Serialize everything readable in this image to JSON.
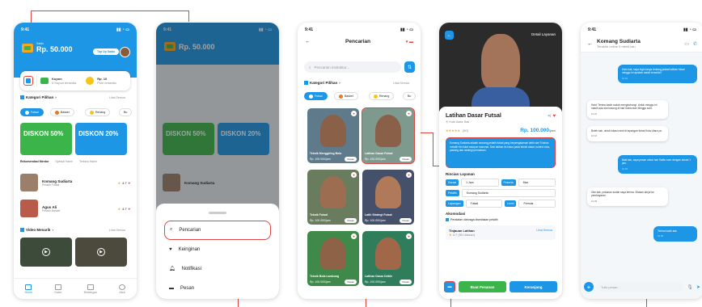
{
  "status_time": "9:41",
  "screen1": {
    "balance_label": "Saldo",
    "balance": "Rp. 50.000",
    "topup": "Top Up Saldo",
    "kupon_label": "Kupon",
    "kupon_sub": "0 Kupon tersedia",
    "poin_label": "Rp. 10",
    "poin_sub": "Poin tersedia",
    "kategori": "Kategori Pilihan",
    "lihat": "Lihat Semua",
    "chips": [
      "Futsal",
      "Basket",
      "Renang",
      "Bu"
    ],
    "promo1": "DISKON 50%",
    "promo2": "DISKON 20%",
    "tabs": [
      "Rekomendasi Mentor",
      "Spesial Harini",
      "Terbaru Harini"
    ],
    "rec": [
      {
        "name": "Komang Sudiarta",
        "sub": "Pelatih Futsal",
        "rating": "4.7"
      },
      {
        "name": "Agus Ali",
        "sub": "Pelatih Basket",
        "rating": "4.7"
      }
    ],
    "video_title": "Video Menarik",
    "nav": [
      "Home",
      "Galeri",
      "Bimbingan",
      "Akun"
    ]
  },
  "screen2": {
    "balance": "Rp. 50.000",
    "menu": [
      "Pencarian",
      "Keinginan",
      "Notifikasi",
      "Pesan"
    ]
  },
  "screen3": {
    "title": "Pencarian",
    "search_placeholder": "Pencarian instruktur...",
    "kategori": "Kategori Pilihan",
    "lihat": "Lihat Semua",
    "chips": [
      "Futsal",
      "Basket",
      "Renang",
      "Bu"
    ],
    "tiles": [
      {
        "cap": "Teknik Menggiring Bola",
        "price": "Rp. 100.000/jam",
        "btn": "Pesan"
      },
      {
        "cap": "Latihan Dasar Futsal",
        "price": "Rp. 100.000/jam",
        "btn": "Pesan"
      },
      {
        "cap": "Teknik Futsal",
        "price": "Rp. 100.000/jam",
        "btn": "Pesan"
      },
      {
        "cap": "Latih Strategi Futsal",
        "price": "Rp. 100.000/jam",
        "btn": "Pesan"
      },
      {
        "cap": "Teknik Bola Lambung",
        "price": "Rp. 100.000/jam",
        "btn": "Pesan"
      },
      {
        "cap": "Latihan Dasar Drible",
        "price": "Rp. 100.000/jam",
        "btn": "Pesan"
      }
    ]
  },
  "screen4": {
    "header": "Detail Layanan",
    "title": "Latihan Dasar Futsal",
    "location": "Kuta Utara, Bali",
    "reviews": "(50)",
    "price": "Rp. 100.000",
    "per": "/jam",
    "desc": "Komang Sudiarta adalah seorang pelatih futsal yang berpengalaman lebih dari 5 tahun melatih tim lokal maupun nasional. Sesi latihan ini fokus pada teknik dasar, kontrol bola, passing dan strategi permainan.",
    "rincian": "Rincian Layanan",
    "rows": [
      [
        "Durasi",
        "1 Jam",
        "Peserta",
        "Max"
      ],
      [
        "Pelatih",
        "Komang Sudiarta"
      ],
      [
        "Lapangan",
        "Futsal",
        "Level",
        "Pemula"
      ]
    ],
    "akomodasi": "Akomodasi",
    "akomodasi_item": "Peralatan olahraga disediakan pelatih",
    "tinjauan": "Tinjauan Latihan",
    "tinjauan_sub": "4.7 (50 Ulasan)",
    "lihat": "Lihat Semua",
    "btn_pesan": "Buat Pesanan",
    "btn_keranjang": "Keranjang"
  },
  "screen5": {
    "name": "Komang Sudiarta",
    "sub": "Terakhir online 5 menit lalu",
    "messages": [
      {
        "who": "me",
        "text": "Halo kak, saya ingin tanya tentang jadwal latihan futsal minggu ini apakah masih tersedia?",
        "time": "10.01"
      },
      {
        "who": "them",
        "text": "Halo! Terima kasih sudah menghubungi. Untuk minggu ini masih ada slot kosong di hari Sabtu dan Minggu sore.",
        "time": "10.03"
      },
      {
        "who": "them",
        "text": "Boleh kak, untuk lokasi nanti di lapangan futsal Kuta Utara ya.",
        "time": "10.04"
      },
      {
        "who": "me",
        "text": "Baik kak, saya pesan untuk hari Sabtu sore dengan durasi 1 jam.",
        "time": "10.06"
      },
      {
        "who": "them",
        "text": "Oke kak, pesanan sudah saya terima. Silakan lanjut ke pembayaran.",
        "time": "10.08"
      },
      {
        "who": "me",
        "text": "Terima kasih kak",
        "time": "10.09"
      }
    ],
    "input_placeholder": "Tulis pesan..."
  }
}
